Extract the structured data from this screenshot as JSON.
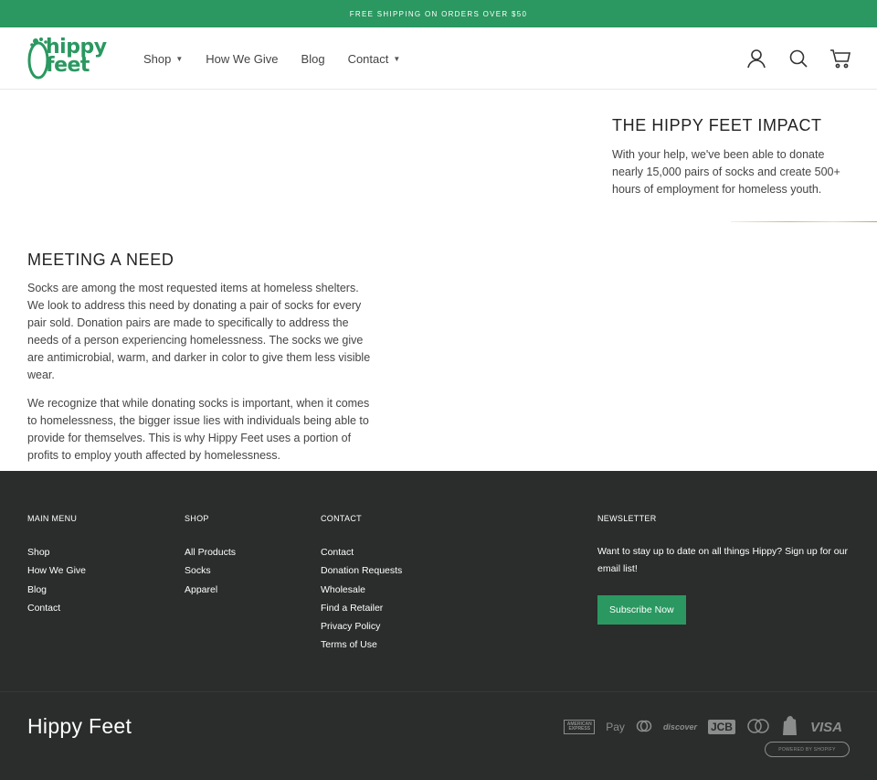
{
  "announcement": "FREE SHIPPING ON ORDERS OVER $50",
  "brand": {
    "logo_text": "hippy\nfeet",
    "accent_color": "#2a9860"
  },
  "nav": {
    "shop": "Shop",
    "how_we_give": "How We Give",
    "blog": "Blog",
    "contact": "Contact"
  },
  "header_icons": [
    "account-icon",
    "search-icon",
    "cart-icon"
  ],
  "impact": {
    "title": "THE HIPPY FEET IMPACT",
    "body": "With your help, we've been able to donate nearly 15,000 pairs of socks and create 500+ hours of employment for homeless youth."
  },
  "need": {
    "title": "MEETING A NEED",
    "p1": "Socks are among the most requested items at homeless shelters. We look to address this need by donating a pair of socks for every pair sold. Donation pairs are made to specifically to address the needs of a person experiencing homelessness. The socks we give are antimicrobial, warm, and darker in color to give them less visible wear.",
    "p2": "We recognize that while donating socks is important, when it comes to homelessness, the bigger issue lies with individuals being able to provide for themselves. This is why Hippy Feet uses a portion of profits to employ youth affected by homelessness."
  },
  "footer": {
    "main_menu": {
      "title": "MAIN MENU",
      "links": [
        "Shop",
        "How We Give",
        "Blog",
        "Contact"
      ]
    },
    "shop": {
      "title": "SHOP",
      "links": [
        "All Products",
        "Socks",
        "Apparel"
      ]
    },
    "contact": {
      "title": "CONTACT",
      "links": [
        "Contact",
        "Donation Requests",
        "Wholesale",
        "Find a Retailer",
        "Privacy Policy",
        "Terms of Use"
      ]
    },
    "newsletter": {
      "title": "NEWSLETTER",
      "text": "Want to stay up to date on all things Hippy? Sign up for our email list!",
      "button": "Subscribe Now"
    },
    "brand_name": "Hippy Feet",
    "payments": [
      "AMERICAN EXPRESS",
      "Pay",
      "discover",
      "JCB",
      "VISA"
    ],
    "powered_by": "POWERED BY SHOPIFY"
  }
}
